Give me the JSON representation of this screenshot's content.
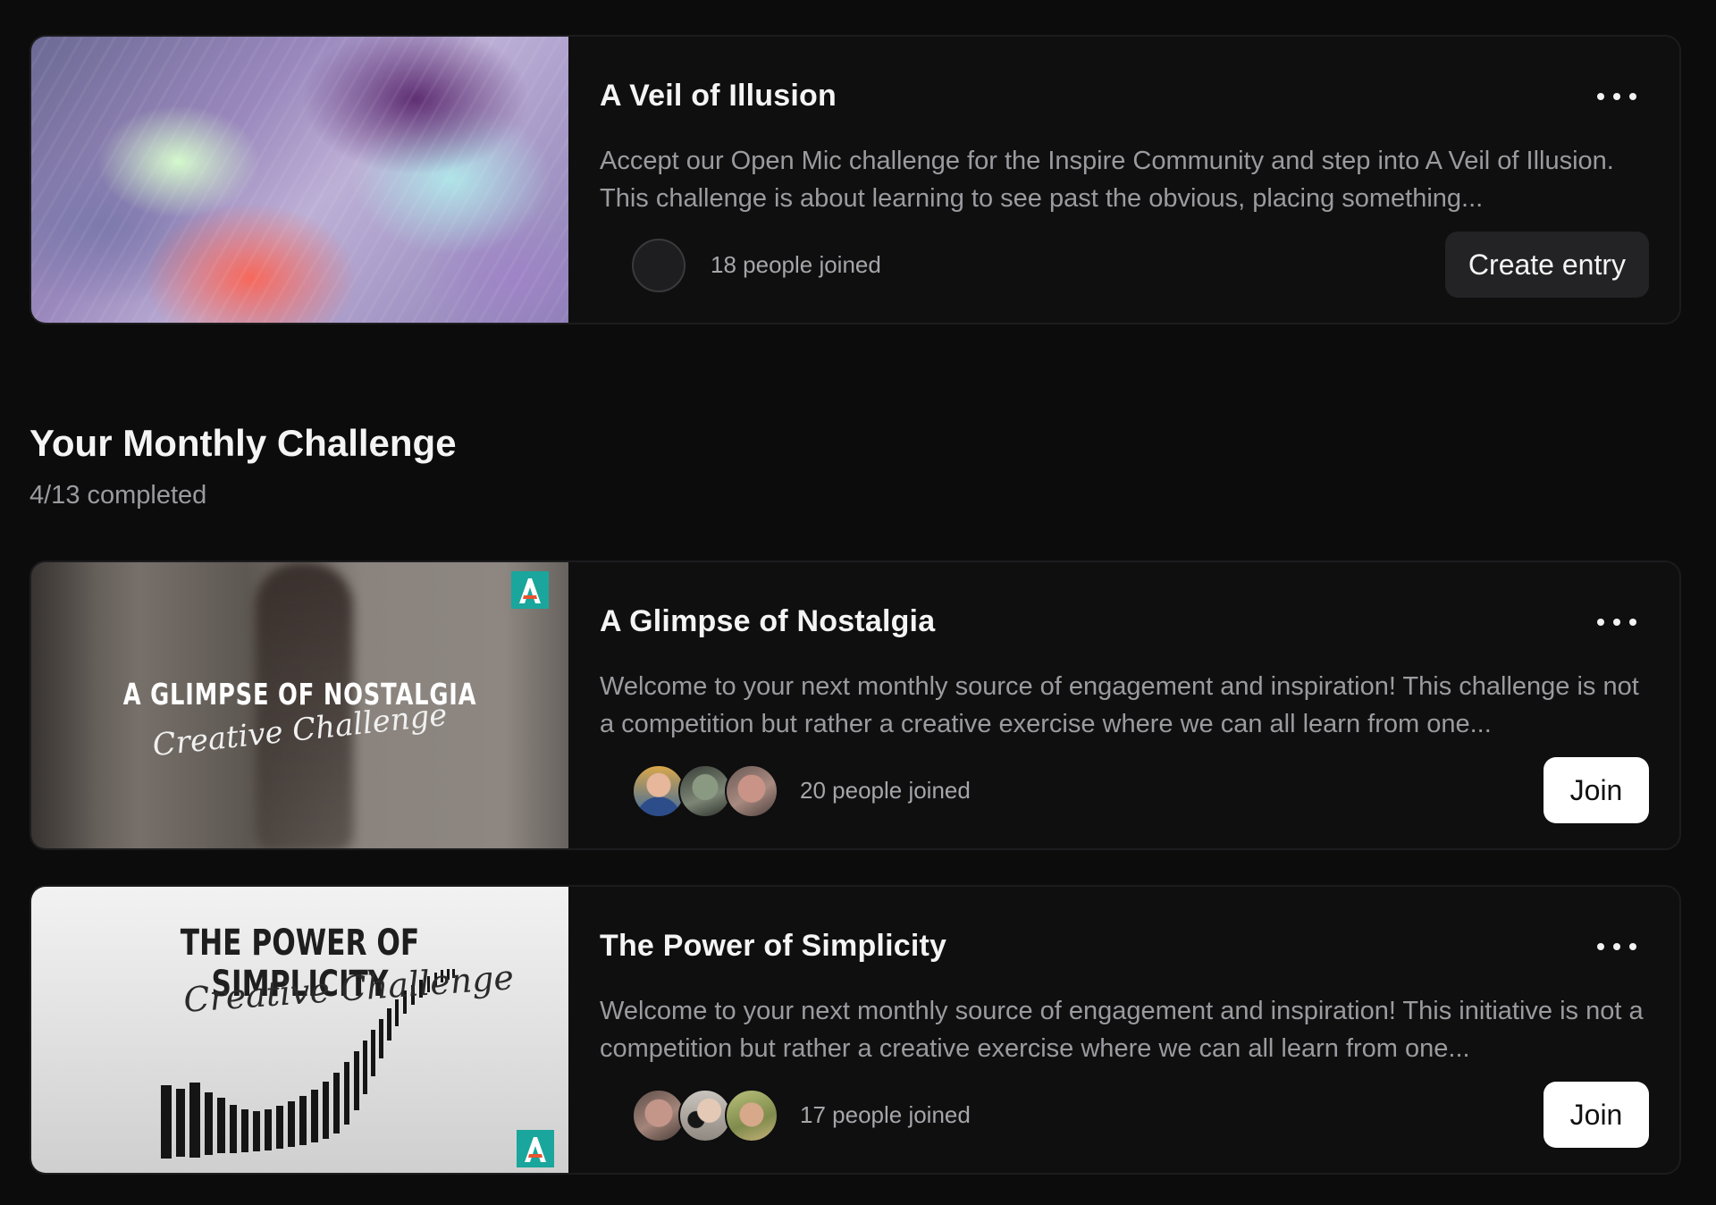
{
  "section": {
    "title": "Your Monthly Challenge",
    "progress": "4/13 completed"
  },
  "cards": [
    {
      "title": "A Veil of Illusion",
      "description": "Accept our Open Mic challenge for the Inspire Community and step into A Veil of Illusion. This challenge is about learning to see past the obvious, placing something...",
      "joined": "18 people joined",
      "action_label": "Create entry"
    },
    {
      "title": "A Glimpse of Nostalgia",
      "description": "Welcome to your next monthly source of engagement and inspiration! This challenge is not a competition but rather a creative exercise where we can all learn from one...",
      "joined": "20 people joined",
      "action_label": "Join",
      "thumb_title": "A GLIMPSE OF NOSTALGIA",
      "thumb_script": "Creative Challenge"
    },
    {
      "title": "The Power of Simplicity",
      "description": "Welcome to your next monthly source of engagement and inspiration! This initiative is not a competition but rather a creative exercise where we can all learn from one...",
      "joined": "17 people joined",
      "action_label": "Join",
      "thumb_title": "THE POWER OF SIMPLICITY",
      "thumb_script": "Creative Challenge"
    }
  ],
  "icons": {
    "more": "more-horizontal-icon",
    "logo": "a-logo-icon"
  },
  "colors": {
    "background": "#0c0c0d",
    "card": "#0f0f10",
    "join_button": "#ffffff",
    "create_button": "#232325",
    "logo_accent": "#1aa69c"
  }
}
